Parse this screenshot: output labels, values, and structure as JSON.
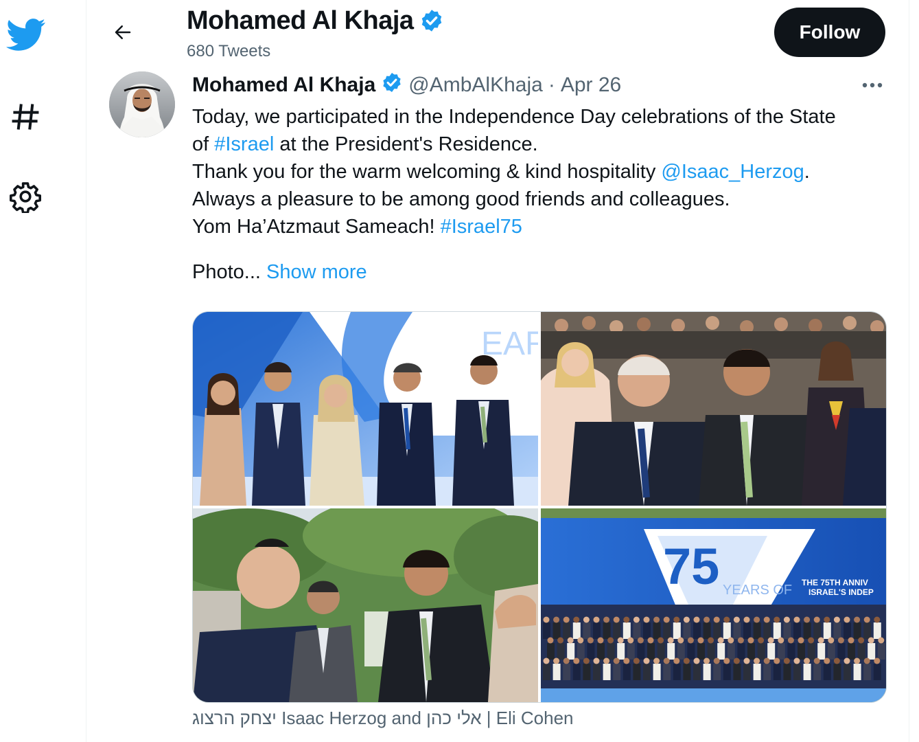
{
  "header": {
    "display_name": "Mohamed Al Khaja",
    "tweet_count": "680 Tweets",
    "follow_label": "Follow"
  },
  "nav": {
    "icons": [
      "twitter-logo-icon",
      "hashtag-icon",
      "gear-icon",
      "back-arrow-icon"
    ]
  },
  "tweet": {
    "author": "Mohamed Al Khaja",
    "handle": "@AmbAlKhaja",
    "separator": "·",
    "date": "Apr 26",
    "lines": {
      "l1": "Today, we participated in the Independence Day celebrations of the State",
      "l2_pre": "of ",
      "l2_link": "#Israel",
      "l2_post": " at the President's Residence.",
      "l3_pre": "Thank you for the warm welcoming & kind hospitality ",
      "l3_link": "@Isaac_Herzog",
      "l3_post": ".",
      "l4": "Always a pleasure to be among good friends and colleagues.",
      "l5_pre": "Yom Ha’Atzmaut Sameach! ",
      "l5_link": "#Israel75",
      "l6_pre": "Photo... ",
      "l6_link": "Show more"
    },
    "media_caption": "יצחק הרצוג Isaac Herzog and אלי כהן | Eli Cohen",
    "media_text": {
      "banner_75": "75",
      "banner_years": "YEARS OF",
      "banner_years_partial": "EARS",
      "banner_line1": "THE 75TH ANNIV",
      "banner_line2": "ISRAEL'S INDEP"
    }
  },
  "colors": {
    "accent": "#1d9bf0",
    "text_primary": "#0f1419",
    "text_secondary": "#536471",
    "follow_bg": "#0f1419",
    "verified": "#1d9bf0",
    "border": "#cfd9de"
  }
}
